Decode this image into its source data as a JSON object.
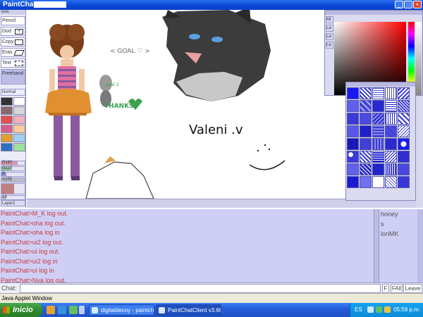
{
  "window": {
    "title": "PaintChat"
  },
  "tools": [
    {
      "label": "Pencil",
      "icon": ""
    },
    {
      "label": "Dod",
      "icon": "+"
    },
    {
      "label": "Copy",
      "icon": ""
    },
    {
      "label": "Eras",
      "icon": ""
    },
    {
      "label": "Text",
      "icon": ""
    },
    {
      "label": "Freehand",
      "icon": ""
    }
  ],
  "panel_title": "tools",
  "mode": "Normal",
  "swatch_colors": [
    "#333333",
    "#ffffff",
    "#8a6a6a",
    "#d6d6d6",
    "#e05050",
    "#f0b0c0",
    "#d4608a",
    "#ffcc99",
    "#e0a030",
    "#a0d0f0",
    "#3070c0",
    "#a0e0a0"
  ],
  "fields": [
    {
      "label": "R180",
      "color": "#c85060",
      "fill": 0.7
    },
    {
      "label": "G117",
      "color": "#50a050",
      "fill": 0.46
    },
    {
      "label": "B",
      "color": "#5050c0",
      "fill": 0.2
    },
    {
      "label": "A255",
      "color": "#808080",
      "fill": 1.0
    },
    {
      "label": "",
      "color": "#c08080",
      "fill": 0.55
    },
    {
      "label": "13",
      "color": "#9090c0",
      "fill": 0.2
    }
  ],
  "layer": "Layer2",
  "picker_tabs": [
    "Mi",
    "La",
    "La",
    "La"
  ],
  "canvas": {
    "goal_text": "< GOAL ♡ >",
    "thanks_text": "THANKS",
    "small_note": "goal 2",
    "name_text": "Valeni .v"
  },
  "chat_lines": [
    "PaintChat>M_K log out.",
    "PaintChat>oha log out.",
    "PaintChat>oha log in",
    "PaintChat>ui2 log out.",
    "PaintChat>ui log out.",
    "PaintChat>ui2 log in",
    "PaintChat>ui log in",
    "PaintChat>Nya log out."
  ],
  "users": [
    "honey",
    "s",
    "loriMK"
  ],
  "chat_input": {
    "label": "Chat:",
    "value": ""
  },
  "chat_buttons": {
    "f": "F",
    "fall": "FAll",
    "leave": "Leave"
  },
  "status_text": "Java Applet Window",
  "taskbar": {
    "start_label": "Inicio",
    "tasks": [
      {
        "label": "digitaldecoy - paintch...",
        "active": false
      },
      {
        "label": "PaintChatClient v3.66",
        "active": true
      }
    ],
    "lang": "ES",
    "clock": "05:59 p.m."
  },
  "colors": {
    "chat_text": "#c83c3c",
    "chat_bg": "#cfcff5",
    "titlebar": "#0a4ad8"
  }
}
